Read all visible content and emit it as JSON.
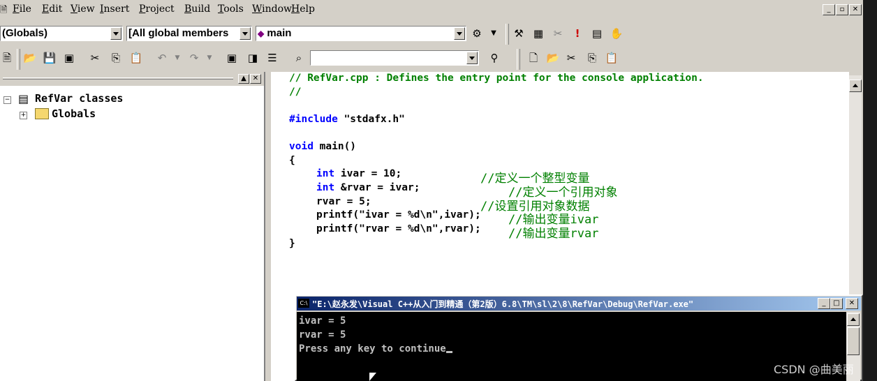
{
  "menu": [
    "File",
    "Edit",
    "View",
    "Insert",
    "Project",
    "Build",
    "Tools",
    "Window",
    "Help"
  ],
  "wizardbar": {
    "class_combo": "(Globals)",
    "filter_combo": "[All global members",
    "member_combo": "main"
  },
  "tree": {
    "root": "RefVar classes",
    "child": "Globals"
  },
  "code": {
    "line1": "// RefVar.cpp : Defines the entry point for the console application.",
    "line2": "//",
    "include_kw": "#include",
    "include_file": " \"stdafx.h\"",
    "void_kw": "void",
    "main_sig": " main()",
    "brace_open": "{",
    "int_kw": "int",
    "decl1": " ivar = 10;",
    "comment1": "//定义一个整型变量",
    "decl2": " &rvar = ivar;",
    "comment2": "//定义一个引用对象",
    "assign": "rvar = 5;",
    "comment3": "//设置引用对象数据",
    "printf1": "printf(\"ivar = %d\\n\",ivar);",
    "comment4": "//输出变量ivar",
    "printf2": "printf(\"rvar = %d\\n\",rvar);",
    "comment5": "//输出变量rvar",
    "brace_close": "}"
  },
  "console": {
    "title": "\"E:\\赵永发\\Visual C++从入门到精通（第2版）6.8\\TM\\sl\\2\\8\\RefVar\\Debug\\RefVar.exe\"",
    "out1": "ivar = 5",
    "out2": "rvar = 5",
    "out3": "Press any key to continue"
  },
  "watermark": "CSDN @曲美丽",
  "colors": {
    "keyword": "#0000ff",
    "comment": "#008000",
    "titlebar_start": "#0a246a",
    "titlebar_end": "#a6caf0"
  }
}
